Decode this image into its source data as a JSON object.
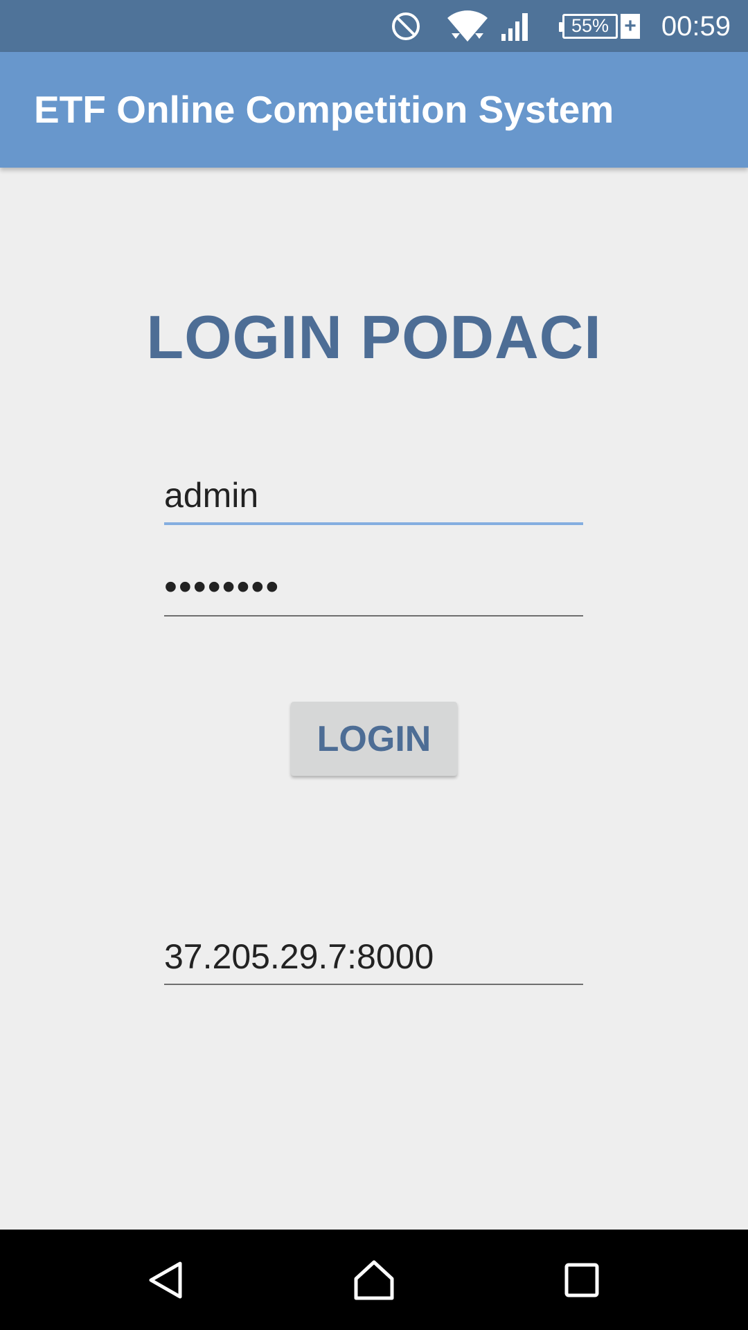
{
  "status_bar": {
    "battery_percent": "55%",
    "time": "00:59",
    "icons": [
      "do-not-disturb-icon",
      "wifi-icon",
      "cell-signal-icon",
      "battery-charging-icon"
    ]
  },
  "app_bar": {
    "title": "ETF Online Competition System"
  },
  "login": {
    "heading": "LOGIN PODACI",
    "username_value": "admin",
    "password_value": "••••••••",
    "button_label": "LOGIN",
    "server_value": "37.205.29.7:8000"
  },
  "nav_bar": {
    "icons": [
      "back-icon",
      "home-icon",
      "recent-apps-icon"
    ]
  },
  "colors": {
    "status_bar": "#4f7399",
    "app_bar": "#6897cc",
    "accent": "#84aee0",
    "heading": "#4d6d95",
    "background": "#eeeeee"
  }
}
